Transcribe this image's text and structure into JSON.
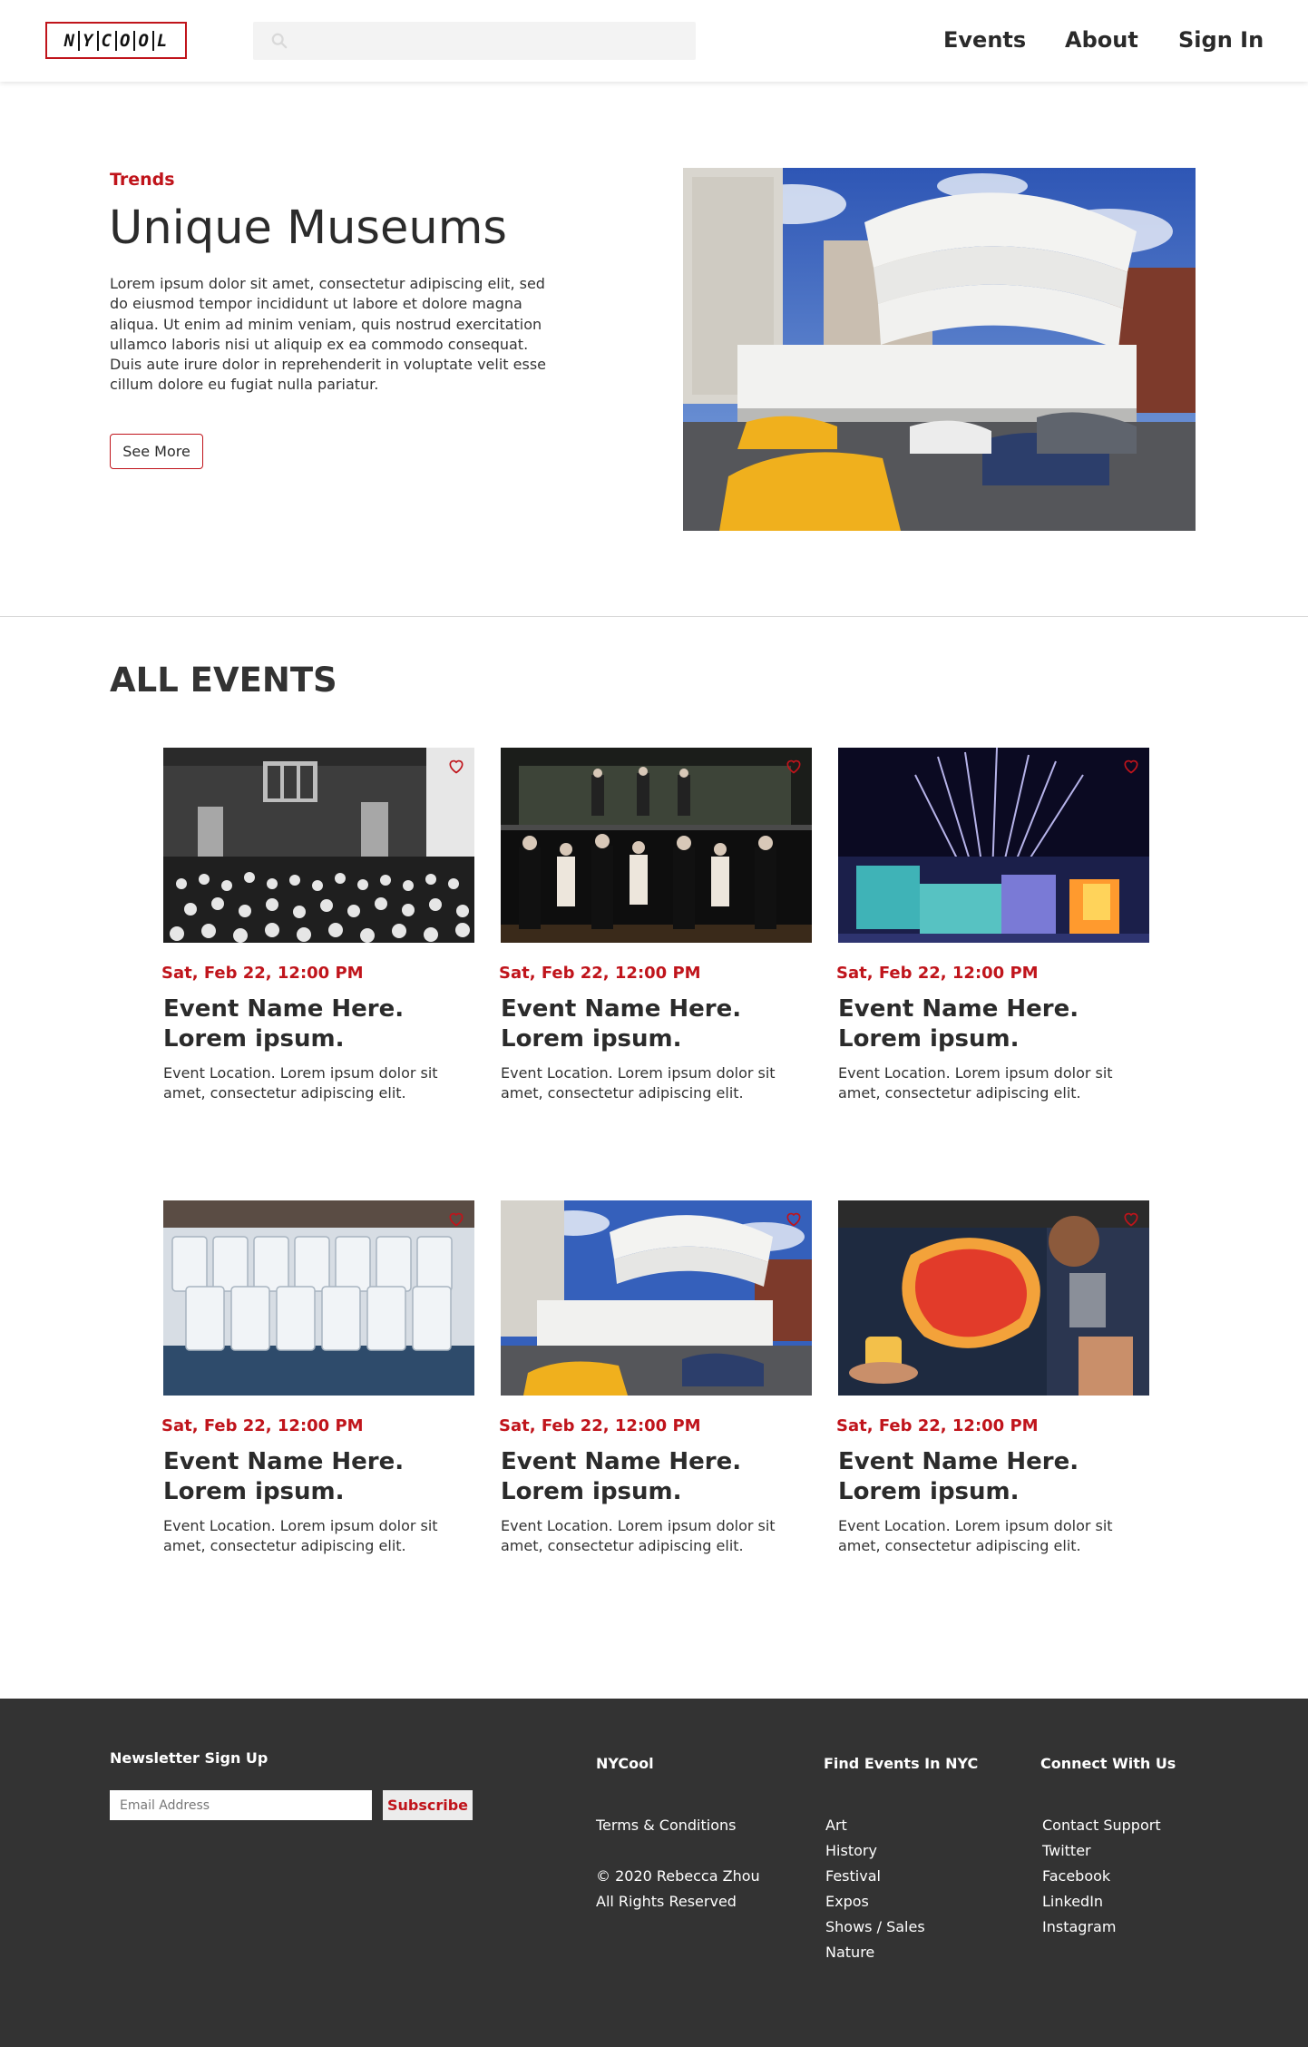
{
  "header": {
    "logo_letters": [
      "N",
      "Y",
      "C",
      "O",
      "O",
      "L"
    ],
    "search": {
      "placeholder": ""
    },
    "nav": {
      "events": "Events",
      "about": "About",
      "sign_in": "Sign In"
    }
  },
  "hero": {
    "eyebrow": "Trends",
    "title": "Unique Museums",
    "description": "Lorem ipsum dolor sit amet, consectetur adipiscing elit, sed do eiusmod tempor incididunt ut labore et dolore magna aliqua. Ut enim ad minim veniam, quis nostrud exercitation ullamco laboris nisi ut aliquip ex ea commodo consequat. Duis aute irure dolor in reprehenderit in voluptate velit esse cillum dolore eu fugiat nulla pariatur.",
    "button": "See More",
    "image_icon": "guggenheim-museum-photo"
  },
  "events": {
    "title": "ALL EVENTS",
    "items": [
      {
        "date": "Sat, Feb 22, 12:00 PM",
        "name": "Event Name Here. Lorem ipsum.",
        "location": "Event Location. Lorem ipsum dolor sit amet, consectetur adipiscing elit.",
        "image": "historic-crowd-photo"
      },
      {
        "date": "Sat, Feb 22, 12:00 PM",
        "name": "Event Name Here. Lorem ipsum.",
        "location": "Event Location. Lorem ipsum dolor sit amet, consectetur adipiscing elit.",
        "image": "stage-performers-photo"
      },
      {
        "date": "Sat, Feb 22, 12:00 PM",
        "name": "Event Name Here. Lorem ipsum.",
        "location": "Event Location. Lorem ipsum dolor sit amet, consectetur adipiscing elit.",
        "image": "ice-castle-fireworks-photo"
      },
      {
        "date": "Sat, Feb 22, 12:00 PM",
        "name": "Event Name Here. Lorem ipsum.",
        "location": "Event Location. Lorem ipsum dolor sit amet, consectetur adipiscing elit.",
        "image": "tasting-glasses-photo"
      },
      {
        "date": "Sat, Feb 22, 12:00 PM",
        "name": "Event Name Here. Lorem ipsum.",
        "location": "Event Location. Lorem ipsum dolor sit amet, consectetur adipiscing elit.",
        "image": "guggenheim-museum-photo"
      },
      {
        "date": "Sat, Feb 22, 12:00 PM",
        "name": "Event Name Here. Lorem ipsum.",
        "location": "Event Location. Lorem ipsum dolor sit amet, consectetur adipiscing elit.",
        "image": "coffee-tea-festival-photo"
      }
    ]
  },
  "footer": {
    "newsletter": {
      "title": "Newsletter Sign Up",
      "placeholder": "Email Address",
      "button": "Subscribe"
    },
    "nycool": {
      "title": "NYCool",
      "terms": "Terms & Conditions",
      "copyright": "© 2020 Rebecca Zhou",
      "rights": "All Rights Reserved"
    },
    "find_events": {
      "title": "Find Events In NYC",
      "links": [
        "Art",
        "History",
        "Festival",
        "Expos",
        "Shows / Sales",
        "Nature"
      ]
    },
    "connect": {
      "title": "Connect With Us",
      "links": [
        "Contact Support",
        "Twitter",
        "Facebook",
        "LinkedIn",
        "Instagram"
      ]
    }
  },
  "colors": {
    "accent": "#c0141b",
    "footer_bg": "#333333",
    "text": "#2b2b2b"
  }
}
